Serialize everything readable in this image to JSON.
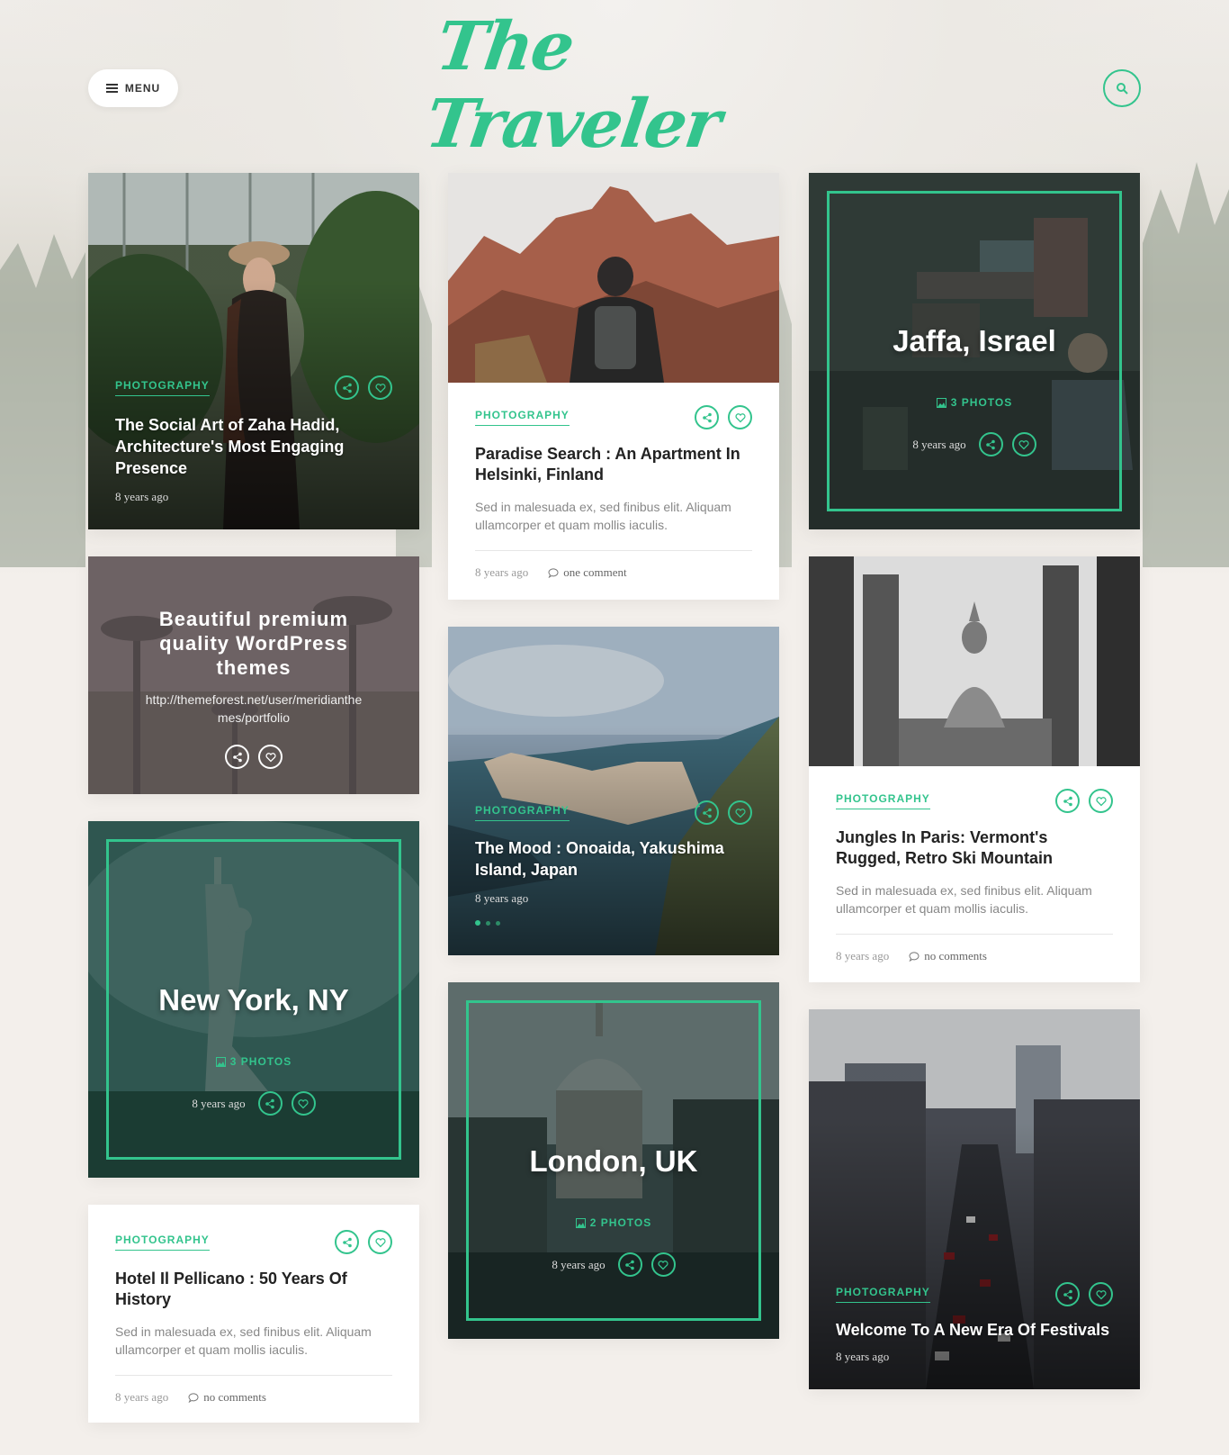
{
  "header": {
    "menu_label": "MENU",
    "logo_text": "The Traveler"
  },
  "colors": {
    "accent": "#33c48d"
  },
  "cards": {
    "zaha": {
      "category": "PHOTOGRAPHY",
      "title": "The Social Art of Zaha Hadid, Architecture's Most Engaging Presence",
      "date": "8 years ago"
    },
    "helsinki": {
      "category": "PHOTOGRAPHY",
      "title": "Paradise Search : An Apartment In Helsinki, Finland",
      "excerpt": "Sed in malesuada ex, sed finibus elit. Aliquam ullamcorper et quam mollis iaculis.",
      "date": "8 years ago",
      "comments": "one comment"
    },
    "jaffa": {
      "title": "Jaffa, Israel",
      "photos": "3 PHOTOS",
      "date": "8 years ago"
    },
    "promo": {
      "title": "Beautiful premium quality WordPress themes",
      "url": "http://themeforest.net/user/meridianthemes/portfolio"
    },
    "yakushima": {
      "category": "PHOTOGRAPHY",
      "title": "The Mood : Onoaida, Yakushima Island, Japan",
      "date": "8 years ago"
    },
    "paris": {
      "category": "PHOTOGRAPHY",
      "title": "Jungles In Paris: Vermont's Rugged, Retro Ski Mountain",
      "excerpt": "Sed in malesuada ex, sed finibus elit. Aliquam ullamcorper et quam mollis iaculis.",
      "date": "8 years ago",
      "comments": "no comments"
    },
    "newyork": {
      "title": "New York, NY",
      "photos": "3 PHOTOS",
      "date": "8 years ago"
    },
    "london": {
      "title": "London, UK",
      "photos": "2 PHOTOS",
      "date": "8 years ago"
    },
    "pellicano": {
      "category": "PHOTOGRAPHY",
      "title": "Hotel Il Pellicano : 50 Years Of History",
      "excerpt": "Sed in malesuada ex, sed finibus elit. Aliquam ullamcorper et quam mollis iaculis.",
      "date": "8 years ago",
      "comments": "no comments"
    },
    "festivals": {
      "category": "PHOTOGRAPHY",
      "title": "Welcome To A New Era Of Festivals",
      "date": "8 years ago"
    }
  },
  "icons": [
    "hamburger-icon",
    "search-icon",
    "share-icon",
    "heart-icon",
    "image-icon",
    "comment-icon"
  ]
}
